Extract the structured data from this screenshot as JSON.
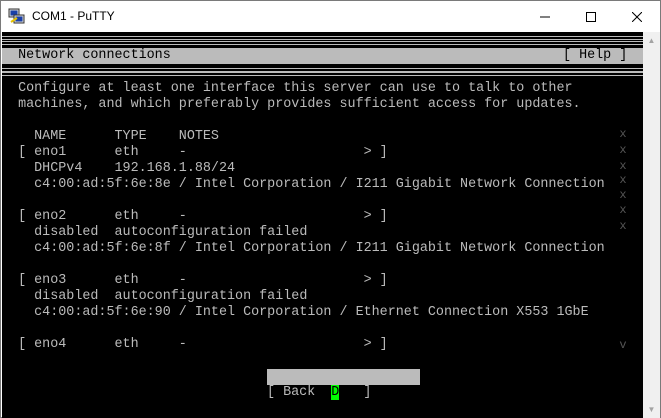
{
  "window": {
    "title": "COM1 - PuTTY",
    "minimize_glyph": "—",
    "maximize_glyph": "☐",
    "close_glyph": "✕",
    "icon": "putty-icon"
  },
  "terminal": {
    "rule": "====================================================================================",
    "header": {
      "title": "  Network connections",
      "help": "[ Help ] "
    },
    "intro": [
      "  Configure at least one interface this server can use to talk to other",
      "  machines, and which preferably provides sufficient access for updates."
    ],
    "columns": "    NAME      TYPE    NOTES",
    "interfaces": [
      {
        "row": "  [ eno1      eth     -                      > ]",
        "lines": [
          "    DHCPv4    192.168.1.88/24",
          "    c4:00:ad:5f:6e:8e / Intel Corporation / I211 Gigabit Network Connection"
        ]
      },
      {
        "row": "  [ eno2      eth     -                      > ]",
        "lines": [
          "    disabled  autoconfiguration failed",
          "    c4:00:ad:5f:6e:8f / Intel Corporation / I211 Gigabit Network Connection"
        ]
      },
      {
        "row": "  [ eno3      eth     -                      > ]",
        "lines": [
          "    disabled  autoconfiguration failed",
          "    c4:00:ad:5f:6e:90 / Intel Corporation / Ethernet Connection X553 1GbE"
        ]
      },
      {
        "row": "  [ eno4      eth     -                      > ]",
        "lines": []
      }
    ],
    "scroll_marks": [
      "x",
      "x",
      "x",
      "x",
      "x",
      "x",
      "x",
      "v"
    ],
    "buttons": {
      "done_open": "[ ",
      "done_cursor": "D",
      "done_rest": "one      ]",
      "back": "[ Back      ]"
    }
  },
  "colors": {
    "terminal_bg": "#000000",
    "terminal_fg": "#bbbbbb",
    "cursor": "#00ff00"
  }
}
